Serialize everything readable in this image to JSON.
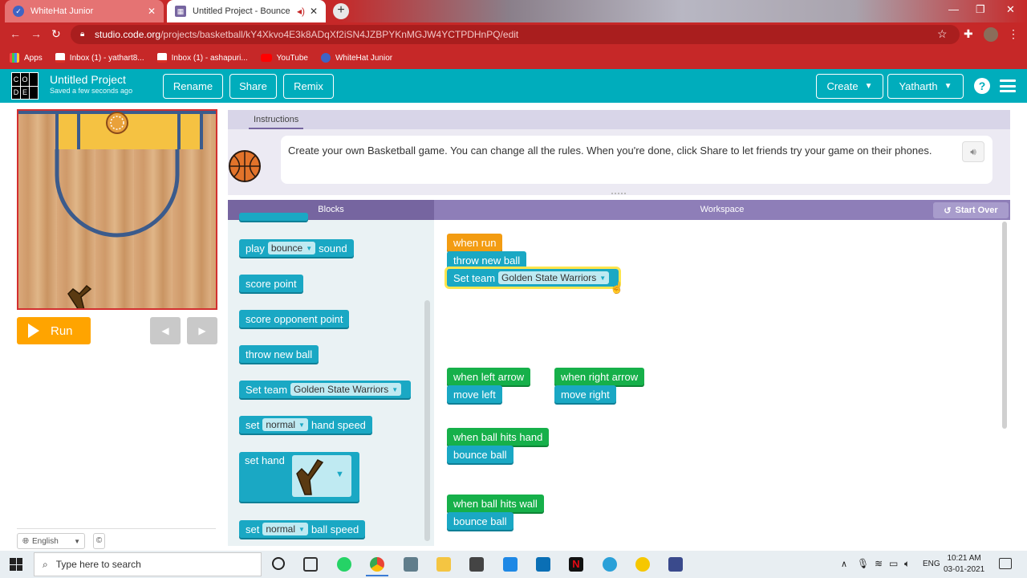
{
  "browser": {
    "tabs": [
      {
        "title": "WhiteHat Junior"
      },
      {
        "title": "Untitled Project - Bounce"
      }
    ],
    "url_host": "studio.code.org",
    "url_path": "/projects/basketball/kY4Xkvo4E3k8ADqXf2iSN4JZBPYKnMGJW4YCTPDHnPQ/edit",
    "bookmarks": [
      "Apps",
      "Inbox (1) - yathart8...",
      "Inbox (1) - ashapuri...",
      "YouTube",
      "WhiteHat Junior"
    ]
  },
  "header": {
    "logo_letters": [
      "C",
      "O",
      "D",
      "E"
    ],
    "project_title": "Untitled Project",
    "saved_status": "Saved a few seconds ago",
    "rename": "Rename",
    "share": "Share",
    "remix": "Remix",
    "create": "Create",
    "user": "Yatharth"
  },
  "game": {
    "run": "Run",
    "language": "English",
    "copyright": "©"
  },
  "instructions": {
    "tab": "Instructions",
    "text": "Create your own Basketball game. You can change all the rules. When you're done, click Share to let friends try your game on their phones."
  },
  "panels": {
    "blocks": "Blocks",
    "workspace": "Workspace",
    "start_over": "Start Over"
  },
  "toolbox": {
    "play": "play",
    "bounce": "bounce",
    "sound": "sound",
    "score_point": "score point",
    "score_opponent": "score opponent point",
    "throw_new_ball": "throw new ball",
    "set_team": "Set team",
    "team_value": "Golden State Warriors",
    "set": "set",
    "normal": "normal",
    "hand_speed": "hand speed",
    "set_hand": "set hand",
    "ball_speed": "ball speed"
  },
  "workspace": {
    "when_run": "when run",
    "throw_new_ball": "throw new ball",
    "set_team": "Set team",
    "team_value": "Golden State Warriors",
    "when_left_arrow": "when left arrow",
    "move_left": "move left",
    "when_right_arrow": "when right arrow",
    "move_right": "move right",
    "when_ball_hits_hand": "when ball hits hand",
    "bounce_ball_1": "bounce ball",
    "when_ball_hits_wall": "when ball hits wall",
    "bounce_ball_2": "bounce ball"
  },
  "taskbar": {
    "search_placeholder": "Type here to search",
    "lang": "ENG",
    "time": "10:21 AM",
    "date": "03-01-2021"
  },
  "colors": {
    "chrome_red": "#c62828",
    "codeorg_teal": "#00adbc",
    "block_cyan": "#1aa8c4",
    "block_green": "#16b04a",
    "block_orange": "#f39c12",
    "run_orange": "#ffa400",
    "panel_purple": "#7665a0"
  }
}
